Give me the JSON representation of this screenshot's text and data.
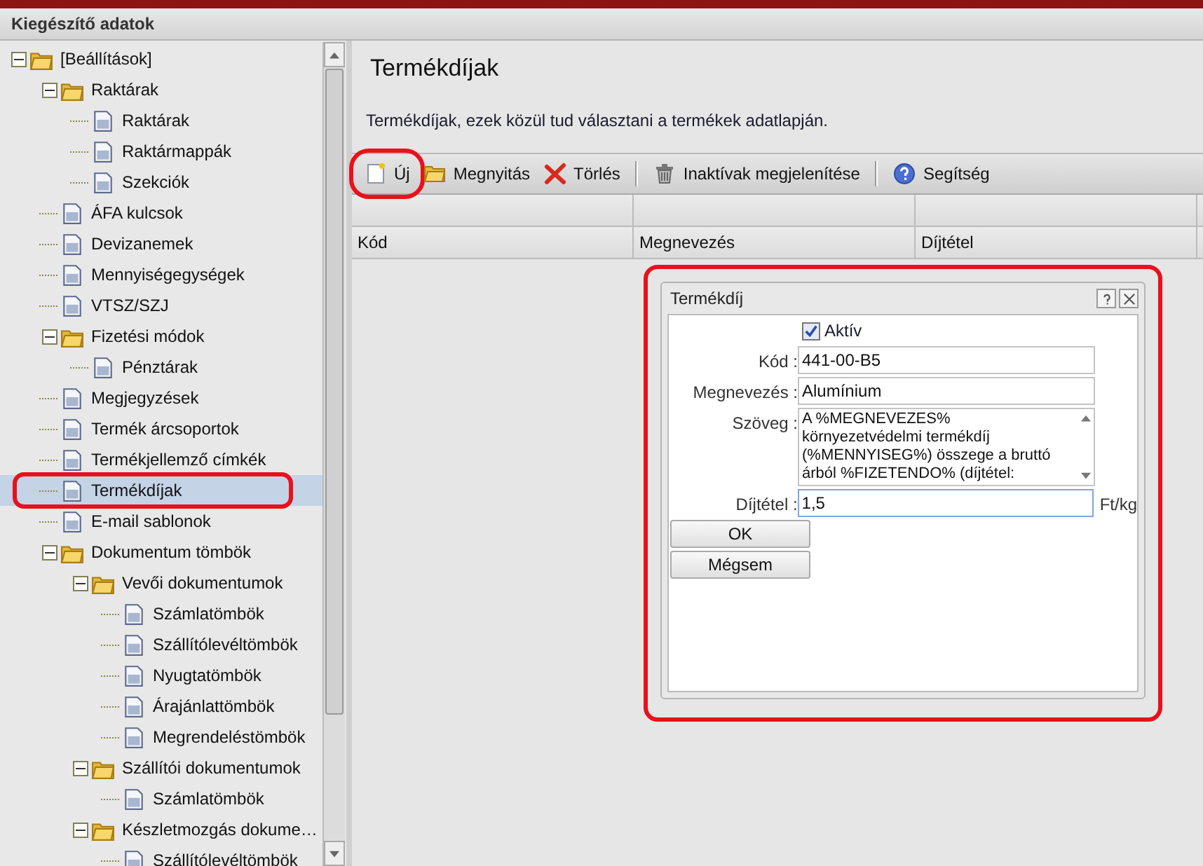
{
  "window": {
    "title": "Kiegészítő adatok"
  },
  "tree": [
    {
      "label": "[Beállítások]",
      "kind": "folder",
      "expanded": true,
      "selected": false,
      "children": [
        {
          "label": "Raktárak",
          "kind": "folder",
          "expanded": true,
          "selected": false,
          "children": [
            {
              "label": "Raktárak",
              "kind": "page",
              "selected": false
            },
            {
              "label": "Raktármappák",
              "kind": "page",
              "selected": false
            },
            {
              "label": "Szekciók",
              "kind": "page",
              "selected": false
            }
          ]
        },
        {
          "label": "ÁFA kulcsok",
          "kind": "page",
          "selected": false
        },
        {
          "label": "Devizanemek",
          "kind": "page",
          "selected": false
        },
        {
          "label": "Mennyiségegységek",
          "kind": "page",
          "selected": false
        },
        {
          "label": "VTSZ/SZJ",
          "kind": "page",
          "selected": false
        },
        {
          "label": "Fizetési módok",
          "kind": "folder",
          "expanded": true,
          "selected": false,
          "children": [
            {
              "label": "Pénztárak",
              "kind": "page",
              "selected": false
            }
          ]
        },
        {
          "label": "Megjegyzések",
          "kind": "page",
          "selected": false
        },
        {
          "label": "Termék árcsoportok",
          "kind": "page",
          "selected": false
        },
        {
          "label": "Termékjellemző címkék",
          "kind": "page",
          "selected": false
        },
        {
          "label": "Termékdíjak",
          "kind": "page",
          "selected": true
        },
        {
          "label": "E-mail sablonok",
          "kind": "page",
          "selected": false
        },
        {
          "label": "Dokumentum tömbök",
          "kind": "folder",
          "expanded": true,
          "selected": false,
          "children": [
            {
              "label": "Vevői dokumentumok",
              "kind": "folder",
              "expanded": true,
              "selected": false,
              "children": [
                {
                  "label": "Számlatömbök",
                  "kind": "page",
                  "selected": false
                },
                {
                  "label": "Szállítólevéltömbök",
                  "kind": "page",
                  "selected": false
                },
                {
                  "label": "Nyugtatömbök",
                  "kind": "page",
                  "selected": false
                },
                {
                  "label": "Árajánlattömbök",
                  "kind": "page",
                  "selected": false
                },
                {
                  "label": "Megrendeléstömbök",
                  "kind": "page",
                  "selected": false
                }
              ]
            },
            {
              "label": "Szállítói dokumentumok",
              "kind": "folder",
              "expanded": true,
              "selected": false,
              "children": [
                {
                  "label": "Számlatömbök",
                  "kind": "page",
                  "selected": false
                }
              ]
            },
            {
              "label": "Készletmozgás dokume…",
              "kind": "folder",
              "expanded": true,
              "selected": false,
              "children": [
                {
                  "label": "Szállítólevéltömbök",
                  "kind": "page",
                  "selected": false
                }
              ]
            }
          ]
        }
      ]
    }
  ],
  "page": {
    "title": "Termékdíjak",
    "description": "Termékdíjak, ezek közül tud választani a termékek adatlapján."
  },
  "toolbar": [
    {
      "label": "Új",
      "kind": "new",
      "highlighted": true
    },
    {
      "label": "Megnyitás",
      "kind": "open",
      "highlighted": false
    },
    {
      "label": "Törlés",
      "kind": "delete",
      "highlighted": false
    },
    {
      "kind": "separator"
    },
    {
      "label": "Inaktívak megjelenítése",
      "kind": "trash",
      "highlighted": false
    },
    {
      "kind": "separator"
    },
    {
      "label": "Segítség",
      "kind": "help",
      "highlighted": false
    }
  ],
  "table": {
    "columns": [
      "Kód",
      "Megnevezés",
      "Díjtétel"
    ]
  },
  "dialog": {
    "title": "Termékdíj",
    "active": {
      "label": "Aktív",
      "checked": true
    },
    "fields": [
      {
        "label": "Kód :",
        "value": "441-00-B5",
        "kind": "input",
        "focused": false
      },
      {
        "label": "Megnevezés :",
        "value": "Alumínium",
        "kind": "input",
        "focused": false
      },
      {
        "label": "Szöveg :",
        "value": "A %MEGNEVEZES% környezetvédelmi termékdíj (%MENNYISEG%) összege a bruttó árból %FIZETENDO% (díjtétel:",
        "kind": "textarea",
        "focused": false
      },
      {
        "label": "Díjtétel :",
        "value": "1,5",
        "kind": "input",
        "focused": true,
        "unit": "Ft/kg"
      }
    ],
    "buttons": [
      "OK",
      "Mégsem"
    ]
  }
}
